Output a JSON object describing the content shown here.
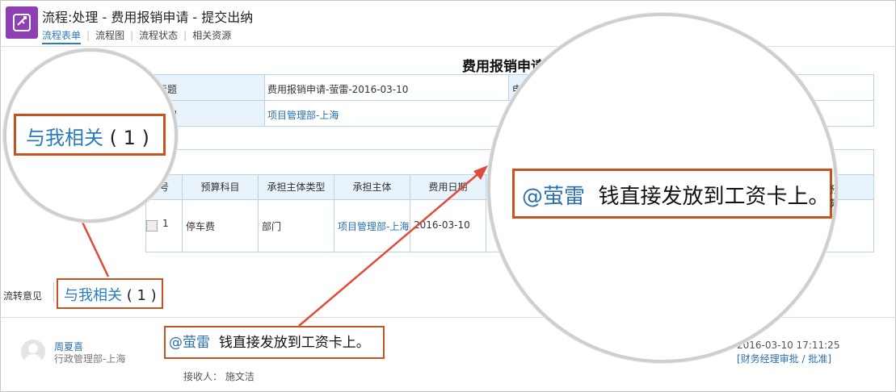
{
  "header": {
    "title": "流程:处理 - 费用报销申请 - 提交出纳",
    "tabs": [
      "流程表单",
      "流程图",
      "流程状态",
      "相关资源"
    ]
  },
  "form": {
    "title": "费用报销申请",
    "info": {
      "row1": {
        "label": "标题",
        "value": "费用报销申请-萤雷-2016-03-10",
        "label2": "申请"
      },
      "row2": {
        "label": "部门",
        "value": "项目管理部-上海"
      }
    },
    "detail": {
      "columns": [
        "号",
        "预算科目",
        "承担主体类型",
        "承担主体",
        "费用日期"
      ],
      "rows": [
        {
          "no": "1",
          "subject": "停车费",
          "type": "部门",
          "entity": "项目管理部-上海",
          "date": "2016-03-10"
        }
      ]
    }
  },
  "opinions": {
    "label": "流转意见",
    "tab_text": "与我相关",
    "tab_count": "( 1 )"
  },
  "comment": {
    "user": "周夏喜",
    "dept": "行政管理部-上海",
    "mention": "@萤雷",
    "text": "钱直接发放到工资卡上。",
    "receiver_label": "接收人：",
    "receiver": "施文洁",
    "time": "2016-03-10   17:11:25",
    "node": "[财务经理审批 / 批准]"
  },
  "magnifier_right": {
    "label": "预算"
  },
  "colors": {
    "accent": "#2a7bbf",
    "highlight": "#c9531f",
    "arrow": "#e04b3a",
    "logo": "#8e3fb4"
  },
  "icons": [
    "workflow-icon",
    "avatar-icon",
    "checkbox-icon"
  ]
}
